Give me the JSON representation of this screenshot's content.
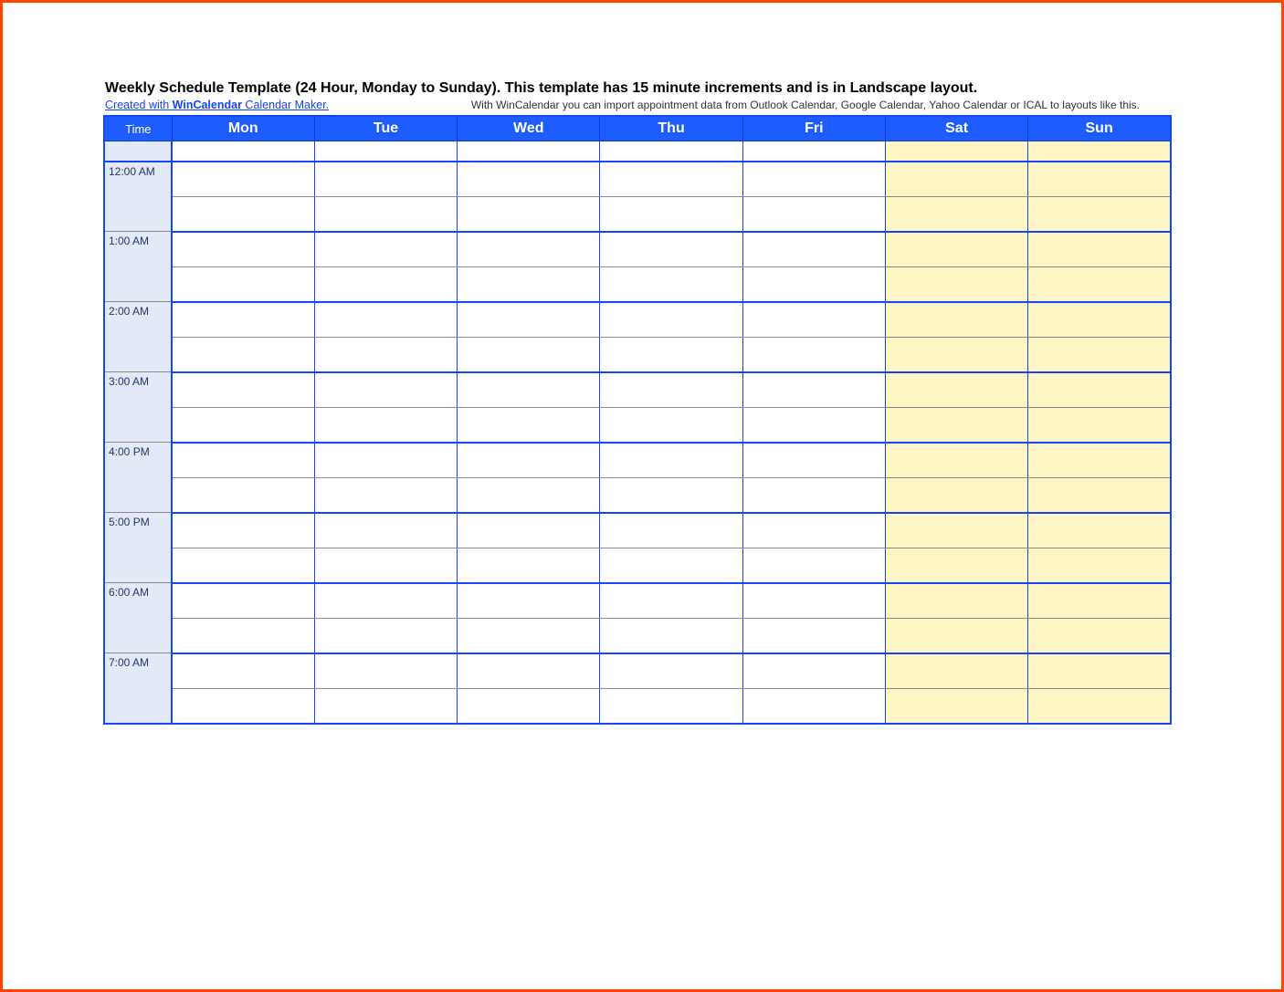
{
  "title": "Weekly Schedule Template (24 Hour, Monday to Sunday).  This template has 15 minute increments and is in Landscape layout.",
  "credit_prefix": "Created with ",
  "credit_brand": "WinCalendar",
  "credit_suffix": " Calendar Maker.",
  "notes": "With WinCalendar you can import appointment data from Outlook Calendar, Google Calendar, Yahoo Calendar or ICAL to layouts like this.",
  "header": {
    "time": "Time",
    "days": [
      "Mon",
      "Tue",
      "Wed",
      "Thu",
      "Fri",
      "Sat",
      "Sun"
    ]
  },
  "time_labels": [
    "12:00 AM",
    "1:00 AM",
    "2:00 AM",
    "3:00 AM",
    "4:00 PM",
    "5:00 PM",
    "6:00 AM",
    "7:00 AM"
  ],
  "weekend_cols": [
    5,
    6
  ]
}
